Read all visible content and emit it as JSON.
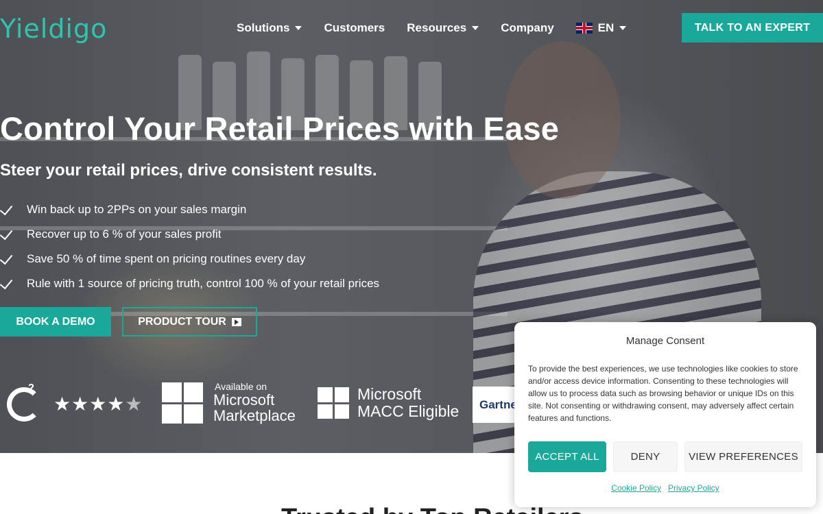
{
  "header": {
    "logo": "Yieldigo",
    "nav": [
      {
        "label": "Solutions",
        "has_dropdown": true
      },
      {
        "label": "Customers",
        "has_dropdown": false
      },
      {
        "label": "Resources",
        "has_dropdown": true
      },
      {
        "label": "Company",
        "has_dropdown": false
      }
    ],
    "language": "EN",
    "cta": "TALK TO AN EXPERT"
  },
  "hero": {
    "title": "Control Your Retail Prices with Ease",
    "subtitle": "Steer your retail prices, drive consistent results.",
    "bullets": [
      "Win back up to 2PPs on your sales margin",
      "Recover up to 6 % of your sales profit",
      "Save 50 % of time spent on pricing routines every day",
      "Rule with 1 source of pricing truth, control 100 % of your retail prices"
    ],
    "book_demo": "BOOK A DEMO",
    "product_tour": "PRODUCT TOUR"
  },
  "badges": {
    "g2_rating": 4.5,
    "g2_superscript": "2",
    "ms_available": "Available on",
    "ms_name": "Microsoft",
    "ms_marketplace": "Marketplace",
    "macc_line1": "Microsoft",
    "macc_line2": "MACC Eligible",
    "gartner": "Gartner"
  },
  "below": {
    "title": "Trusted by Top Retailers"
  },
  "consent": {
    "title": "Manage Consent",
    "body": "To provide the best experiences, we use technologies like cookies to store and/or access device information. Consenting to these technologies will allow us to process data such as browsing behavior or unique IDs on this site. Not consenting or withdrawing consent, may adversely affect certain features and functions.",
    "accept": "ACCEPT ALL",
    "deny": "DENY",
    "view": "VIEW PREFERENCES",
    "cookie_policy": "Cookie Policy",
    "privacy_policy": "Privacy Policy"
  },
  "colors": {
    "accent": "#19a899",
    "logo": "#2ec4b0"
  }
}
